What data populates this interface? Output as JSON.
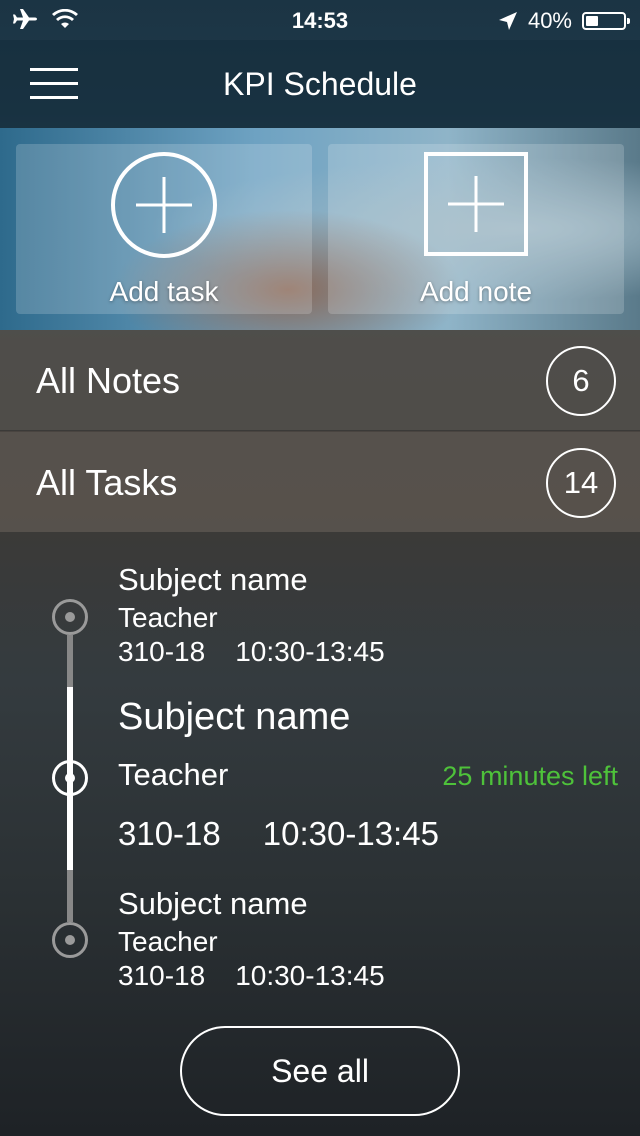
{
  "status_bar": {
    "time": "14:53",
    "battery": "40%",
    "battery_level": 0.4
  },
  "nav": {
    "title": "KPI Schedule"
  },
  "actions": {
    "add_task": "Add task",
    "add_note": "Add note"
  },
  "lists": {
    "notes": {
      "label": "All Notes",
      "count": "6"
    },
    "tasks": {
      "label": "All Tasks",
      "count": "14"
    }
  },
  "schedule": [
    {
      "subject": "Subject name",
      "teacher": "Teacher",
      "room": "310-18",
      "time": "10:30-13:45"
    },
    {
      "subject": "Subject name",
      "teacher": "Teacher",
      "room": "310-18",
      "time": "10:30-13:45",
      "remaining": "25 minutes left"
    },
    {
      "subject": "Subject name",
      "teacher": "Teacher",
      "room": "310-18",
      "time": "10:30-13:45"
    }
  ],
  "see_all": "See all",
  "colors": {
    "remaining_text": "#4ec23a"
  }
}
